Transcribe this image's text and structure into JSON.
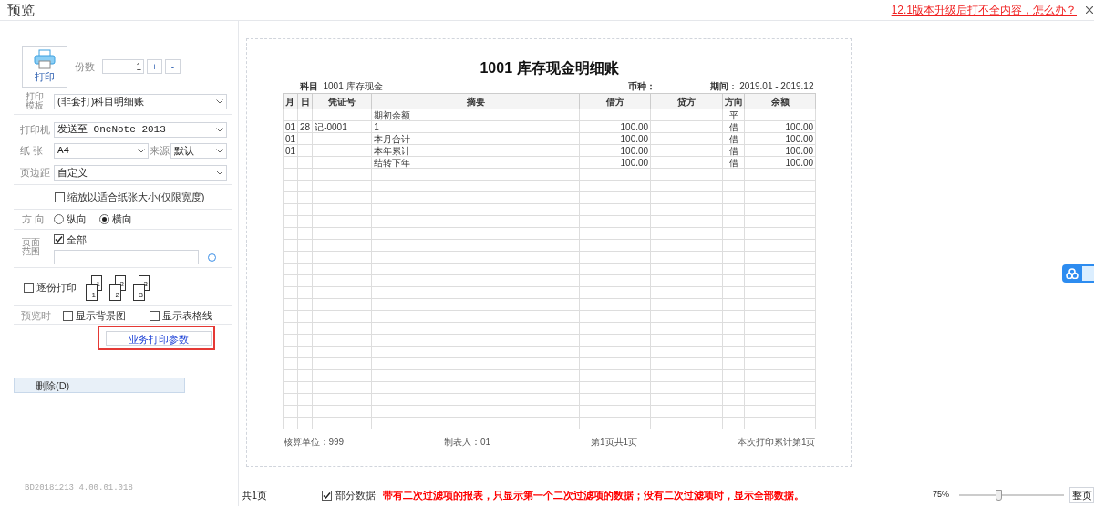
{
  "window": {
    "title": "预览",
    "help_link": "12.1版本升级后打不全内容，怎么办？"
  },
  "print_panel": {
    "print_button": "打印",
    "copies": {
      "label": "份数",
      "value": "1",
      "increment": "+",
      "decrement": "-"
    },
    "template": {
      "label": "打印模板",
      "value": "(非套打)科目明细账"
    },
    "printer": {
      "label": "打印机",
      "value": "发送至 OneNote 2013"
    },
    "paper": {
      "label": "纸 张",
      "value": "A4",
      "source_label": "来源",
      "source_value": "默认"
    },
    "margin": {
      "label": "页边距",
      "value": "自定义"
    },
    "fit_to_paper": {
      "label": "缩放以适合纸张大小(仅限宽度)",
      "checked": false
    },
    "orientation": {
      "label": "方 向",
      "options": [
        {
          "label": "纵向",
          "selected": false
        },
        {
          "label": "横向",
          "selected": true
        }
      ]
    },
    "page_range": {
      "label": "页面范围",
      "all": {
        "label": "全部",
        "checked": true
      }
    },
    "collate": {
      "label": "逐份打印",
      "checked": false,
      "icons": [
        [
          "1",
          "1"
        ],
        [
          "2",
          "2"
        ],
        [
          "3",
          "3"
        ]
      ]
    },
    "preview_options": {
      "label": "预览时",
      "options": [
        {
          "label": "显示背景图",
          "checked": false
        },
        {
          "label": "显示表格线",
          "checked": false
        }
      ]
    },
    "business_params_button": "业务打印参数",
    "delete_button": "删除(D)",
    "version": "BD20181213 4.00.01.018"
  },
  "report": {
    "title": "1001 库存现金明细账",
    "subject_label": "科目",
    "subject": "1001 库存现金",
    "currency": "币种：",
    "period": "**期间**： 2019.01 - 2019.12",
    "columns": [
      "月",
      "日",
      "凭证号",
      "摘要",
      "借方",
      "贷方",
      "方向",
      "余额"
    ],
    "rows": [
      {
        "summary": "期初余额",
        "direction": "平"
      },
      {
        "month": "01",
        "day": "28",
        "voucher": "记-0001",
        "summary": "1",
        "debit": "100.00",
        "direction": "借",
        "balance": "100.00"
      },
      {
        "month": "01",
        "summary": "本月合计",
        "debit": "100.00",
        "direction": "借",
        "balance": "100.00"
      },
      {
        "month": "01",
        "summary": "本年累计",
        "debit": "100.00",
        "direction": "借",
        "balance": "100.00"
      },
      {
        "summary": "结转下年",
        "debit": "100.00",
        "direction": "借",
        "balance": "100.00"
      }
    ],
    "footer": [
      "核算单位：999",
      "制表人：01",
      "第1页共1页",
      "本次打印累计第1页"
    ]
  },
  "status_bar": {
    "page_count": "共1页",
    "partial_data": {
      "label": "部分数据",
      "checked": true
    },
    "notice": "带有二次过滤项的报表，只显示第一个二次过滤项的数据；没有二次过滤项时，显示全部数据。",
    "zoom": "75%",
    "zoom_slider": {
      "level": 0.37
    },
    "fit_page_button": "整页"
  }
}
